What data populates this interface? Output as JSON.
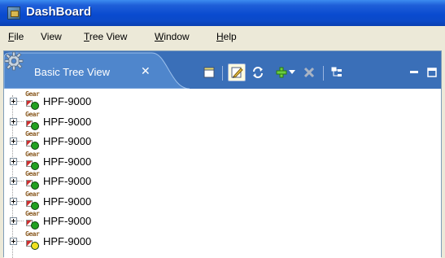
{
  "window": {
    "title": "DashBoard"
  },
  "menu": [
    {
      "mnemonic": "F",
      "rest": "ile"
    },
    {
      "mnemonic": "",
      "rest": "View"
    },
    {
      "mnemonic": "T",
      "rest": "ree View"
    },
    {
      "mnemonic": "W",
      "rest": "indow"
    },
    {
      "mnemonic": "H",
      "rest": "elp"
    }
  ],
  "view": {
    "tab_label": "Basic Tree View",
    "close_glyph": "✕",
    "toolbar": [
      {
        "icon": "new-view-icon"
      },
      {
        "icon": "edit-icon",
        "active": true
      },
      {
        "icon": "refresh-icon"
      },
      {
        "icon": "add-icon"
      },
      {
        "icon": "dropdown-arrow-icon"
      },
      {
        "icon": "delete-icon"
      },
      {
        "icon": "tree-layout-icon"
      },
      {
        "icon": "minimize-icon"
      },
      {
        "icon": "maximize-icon"
      }
    ]
  },
  "tree": {
    "gear_text": "Gear",
    "nodes": [
      {
        "label": "HPF-9000",
        "status": "green"
      },
      {
        "label": "HPF-9000",
        "status": "green"
      },
      {
        "label": "HPF-9000",
        "status": "green"
      },
      {
        "label": "HPF-9000",
        "status": "green"
      },
      {
        "label": "HPF-9000",
        "status": "green"
      },
      {
        "label": "HPF-9000",
        "status": "green"
      },
      {
        "label": "HPF-9000",
        "status": "green"
      },
      {
        "label": "HPF-9000",
        "status": "yellow"
      }
    ]
  },
  "colors": {
    "status_green": "#22a020",
    "status_yellow": "#f0e020",
    "header_blue": "#3a6fb8"
  }
}
